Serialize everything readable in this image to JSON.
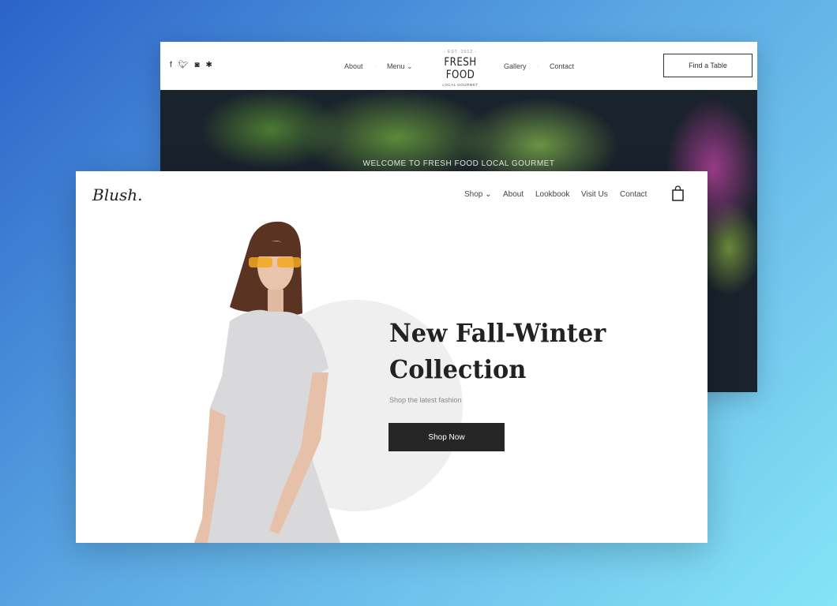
{
  "back_site": {
    "social": [
      "facebook-icon",
      "twitter-icon",
      "instagram-icon",
      "yelp-icon"
    ],
    "nav": [
      "About",
      "Menu",
      "Gallery",
      "Contact"
    ],
    "logo": {
      "est": "- EST. 2012 -",
      "name": "FRESH FOOD",
      "sub": "LOCAL GOURMET"
    },
    "cta": "Find a Table",
    "hero_text": "WELCOME TO FRESH FOOD LOCAL GOURMET"
  },
  "front_site": {
    "logo": "Blush.",
    "nav": [
      "Shop",
      "About",
      "Lookbook",
      "Visit Us",
      "Contact"
    ],
    "hero": {
      "title_line1": "New Fall-Winter",
      "title_line2": "Collection",
      "subtitle": "Shop the latest fashion",
      "cta": "Shop Now"
    }
  }
}
